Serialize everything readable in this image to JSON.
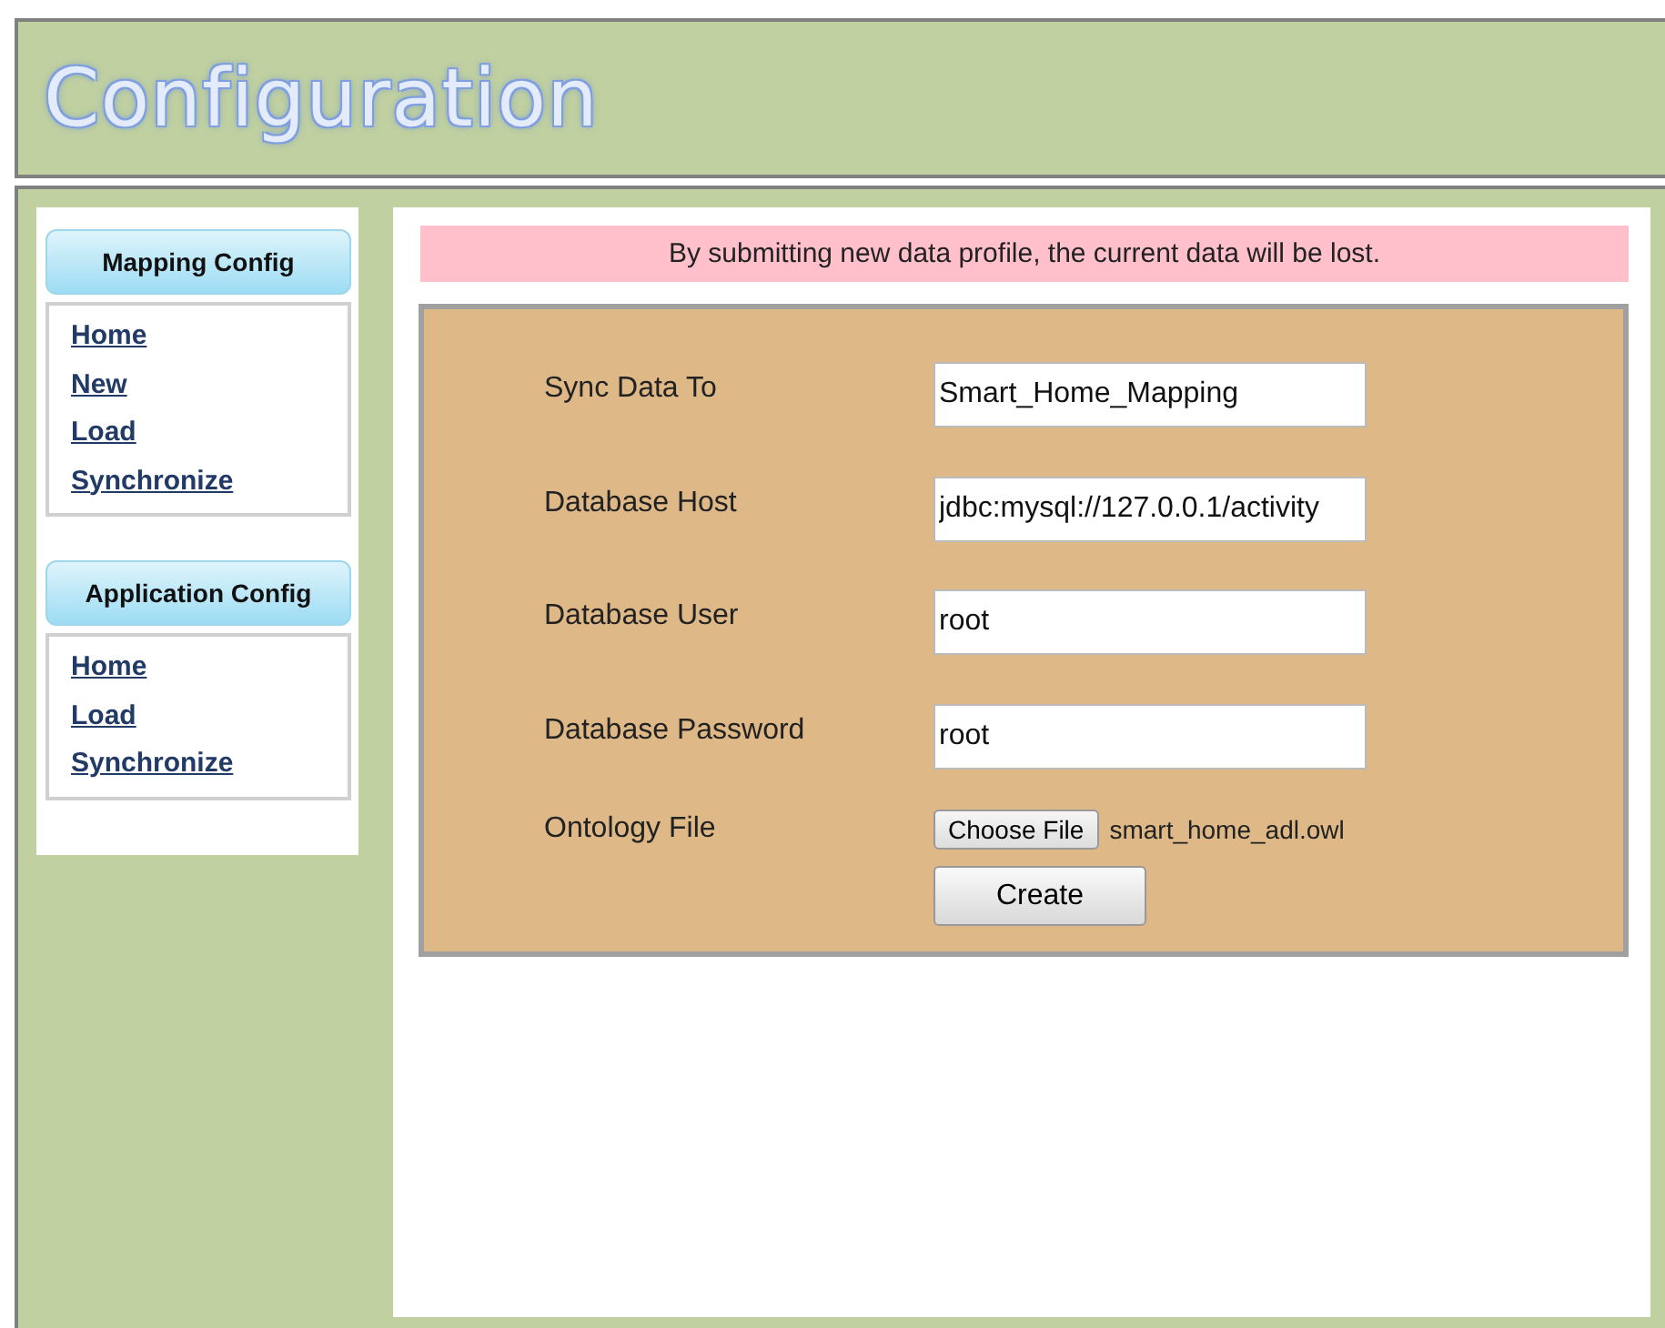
{
  "header": {
    "title": "Configuration"
  },
  "sidebar": {
    "sections": [
      {
        "heading": "Mapping Config",
        "links": [
          "Home",
          "New",
          "Load",
          "Synchronize"
        ]
      },
      {
        "heading": "Application Config",
        "links": [
          "Home",
          "Load",
          "Synchronize"
        ]
      }
    ]
  },
  "warning": "By submitting new data profile, the current data will be lost.",
  "form": {
    "fields": [
      {
        "kind": "text",
        "label": "Sync Data To",
        "value": "Smart_Home_Mapping"
      },
      {
        "kind": "text",
        "label": "Database Host",
        "value": "jdbc:mysql://127.0.0.1/activity"
      },
      {
        "kind": "text",
        "label": "Database User",
        "value": "root"
      },
      {
        "kind": "text",
        "label": "Database Password",
        "value": "root"
      },
      {
        "kind": "file",
        "label": "Ontology File",
        "button": "Choose File",
        "value": "smart_home_adl.owl"
      }
    ],
    "submit": "Create"
  }
}
